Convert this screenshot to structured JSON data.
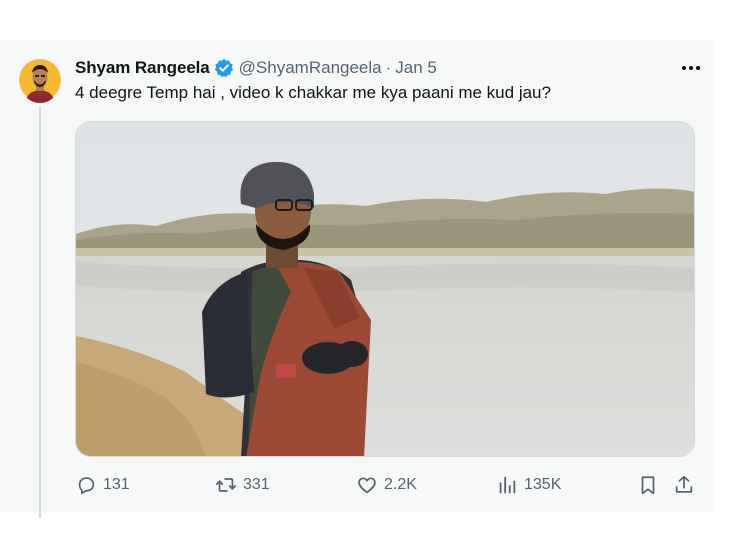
{
  "tweet": {
    "author_name": "Shyam Rangeela",
    "handle": "@ShyamRangeela",
    "separator": "·",
    "date": "Jan 5",
    "text": "4 deegre Temp hai , video k chakkar me kya paani me kud jau?",
    "verified_color": "#1d9bf0"
  },
  "actions": {
    "replies": "131",
    "retweets": "331",
    "likes": "2.2K",
    "views": "135K"
  },
  "icons": [
    "more-icon",
    "reply-icon",
    "retweet-icon",
    "like-icon",
    "views-icon",
    "bookmark-icon",
    "share-icon",
    "verified-badge-icon"
  ]
}
